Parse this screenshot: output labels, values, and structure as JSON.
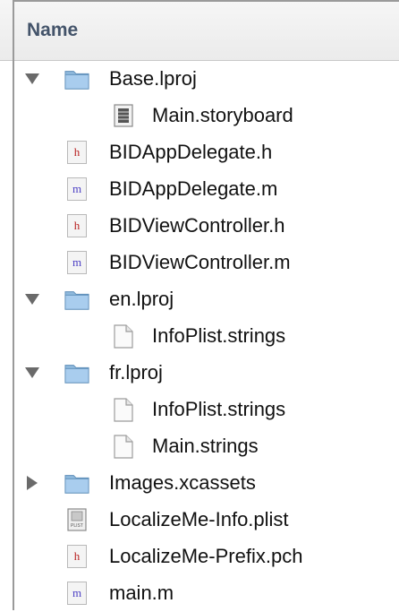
{
  "header": {
    "column_name": "Name"
  },
  "icons": {
    "header": "h",
    "implementation": "m",
    "plist": "PLIST"
  },
  "colors": {
    "header_text": "#44546a",
    "folder": "#8fb9dd",
    "h_file": "#b82121",
    "m_file": "#4b3ec4"
  },
  "tree": {
    "base_lproj": "Base.lproj",
    "main_storyboard": "Main.storyboard",
    "appdelegate_h": "BIDAppDelegate.h",
    "appdelegate_m": "BIDAppDelegate.m",
    "viewcontroller_h": "BIDViewController.h",
    "viewcontroller_m": "BIDViewController.m",
    "en_lproj": "en.lproj",
    "en_infoplist_strings": "InfoPlist.strings",
    "fr_lproj": "fr.lproj",
    "fr_infoplist_strings": "InfoPlist.strings",
    "fr_main_strings": "Main.strings",
    "images_xcassets": "Images.xcassets",
    "info_plist": "LocalizeMe-Info.plist",
    "prefix_pch": "LocalizeMe-Prefix.pch",
    "main_m": "main.m"
  }
}
